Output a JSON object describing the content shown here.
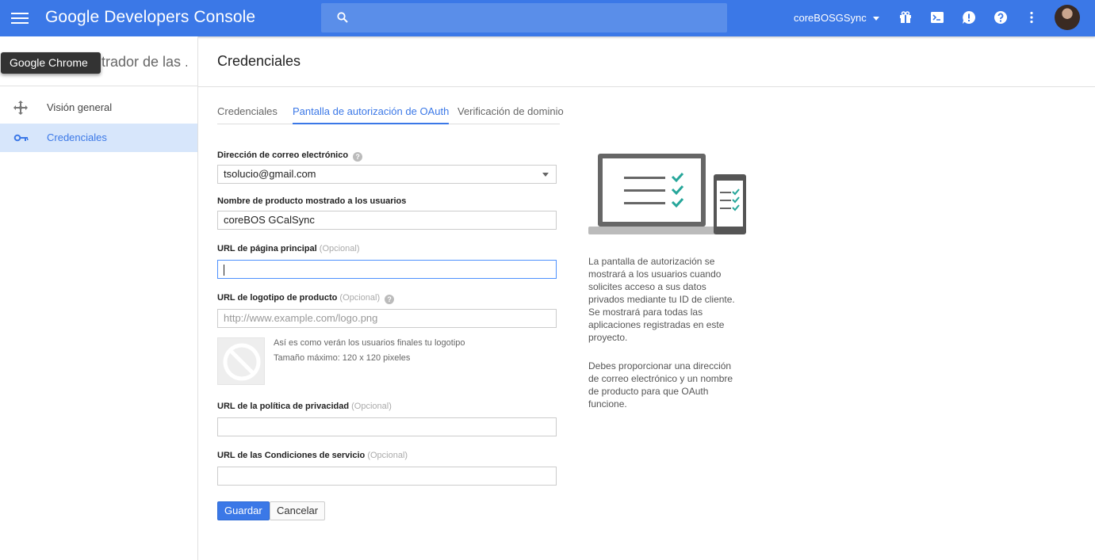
{
  "app": {
    "title": "Google Developers Console",
    "project": "coreBOSGSync"
  },
  "search": {
    "placeholder": ""
  },
  "topbar_icons": [
    "gift-icon",
    "terminal-icon",
    "feedback-icon",
    "help-icon",
    "more-vert-icon"
  ],
  "tooltip": "Google Chrome",
  "sidebar": {
    "title": "trador de las .",
    "items": [
      {
        "label": "Visión general",
        "icon": "overview-icon",
        "active": false
      },
      {
        "label": "Credenciales",
        "icon": "key-icon",
        "active": true
      }
    ]
  },
  "page": {
    "title": "Credenciales",
    "tabs": [
      {
        "label": "Credenciales",
        "active": false
      },
      {
        "label": "Pantalla de autorización de OAuth",
        "active": true
      },
      {
        "label": "Verificación de dominio",
        "active": false
      }
    ]
  },
  "form": {
    "email": {
      "label": "Dirección de correo electrónico",
      "value": "tsolucio@gmail.com"
    },
    "product_name": {
      "label": "Nombre de producto mostrado a los usuarios",
      "value": "coreBOS GCalSync"
    },
    "homepage": {
      "label": "URL de página principal",
      "optional": "(Opcional)",
      "value": ""
    },
    "logo": {
      "label": "URL de logotipo de producto",
      "optional": "(Opcional)",
      "placeholder": "http://www.example.com/logo.png",
      "hint1": "Así es como verán los usuarios finales tu logotipo",
      "hint2": "Tamaño máximo: 120 x 120 pixeles"
    },
    "privacy": {
      "label": "URL de la política de privacidad",
      "optional": "(Opcional)",
      "value": ""
    },
    "terms": {
      "label": "URL de las Condiciones de servicio",
      "optional": "(Opcional)",
      "value": ""
    },
    "save_label": "Guardar",
    "cancel_label": "Cancelar"
  },
  "info": {
    "para1": "La pantalla de autorización se mostrará a los usuarios cuando solicites acceso a sus datos privados mediante tu ID de cliente. Se mostrará para todas las aplicaciones registradas en este proyecto.",
    "para2": "Debes proporcionar una dirección de correo electrónico y un nombre de producto para que OAuth funcione."
  },
  "colors": {
    "primary": "#3b78e7",
    "accent_check": "#26a69a",
    "sidebar_active": "#d7e6fb"
  }
}
